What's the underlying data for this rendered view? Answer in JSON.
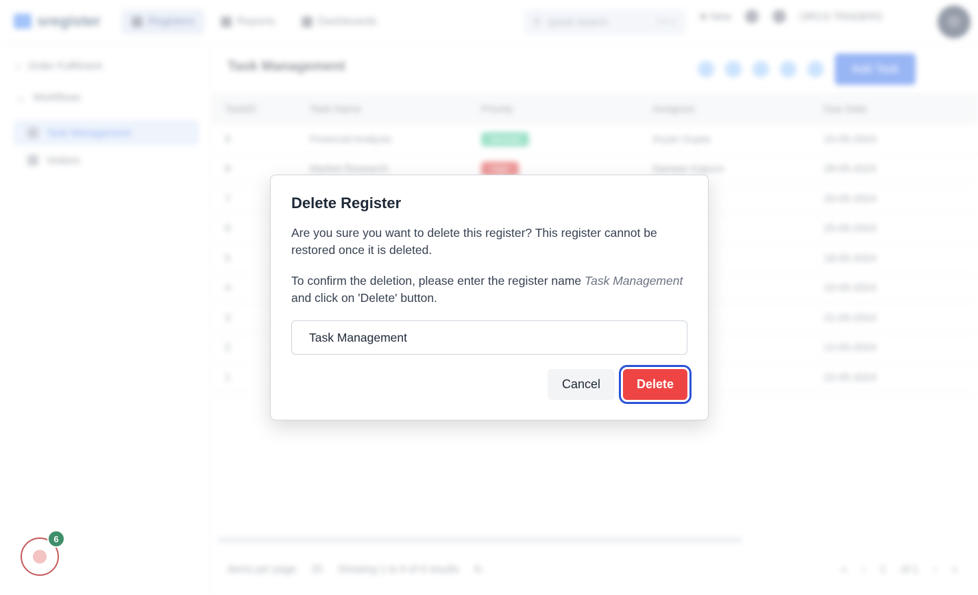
{
  "app": {
    "logo_text": "sregister",
    "nav": [
      "Registers",
      "Reports",
      "Dashboards"
    ],
    "quick_search": "Quick search",
    "quick_search_kbd": "Ctrl K",
    "new_label": "New",
    "org_name": "ORCO TRADERS",
    "avatar_initial": "O"
  },
  "sidebar": {
    "items": [
      {
        "label": "Order Fulfilment"
      },
      {
        "label": "Workflows"
      },
      {
        "label": "Task Management"
      },
      {
        "label": "Visitors"
      }
    ]
  },
  "main": {
    "title": "Task Management",
    "add_button": "Add Task",
    "columns": [
      "TaskID",
      "Task Name",
      "Priority",
      "Assignee",
      "Due Date"
    ],
    "rows": [
      {
        "id": "9",
        "name": "Financial Analysis",
        "priority": "Normal",
        "priority_color": "#34c38f",
        "assignee": "Aryan Gupta",
        "due": "15-05-2024"
      },
      {
        "id": "8",
        "name": "Market Research",
        "priority": "High",
        "priority_color": "#dc2626",
        "assignee": "Sameer Kapoor",
        "due": "28-05-2024"
      },
      {
        "id": "7",
        "name": "",
        "priority": "",
        "priority_color": "",
        "assignee": "",
        "due": "20-05-2024"
      },
      {
        "id": "6",
        "name": "",
        "priority": "",
        "priority_color": "",
        "assignee": "",
        "due": "25-05-2024"
      },
      {
        "id": "5",
        "name": "",
        "priority": "",
        "priority_color": "",
        "assignee": "",
        "due": "18-05-2024"
      },
      {
        "id": "4",
        "name": "",
        "priority": "",
        "priority_color": "",
        "assignee": "",
        "due": "10-05-2024"
      },
      {
        "id": "3",
        "name": "",
        "priority": "",
        "priority_color": "",
        "assignee": "",
        "due": "21-05-2024"
      },
      {
        "id": "2",
        "name": "",
        "priority": "",
        "priority_color": "",
        "assignee": "",
        "due": "12-05-2024"
      },
      {
        "id": "1",
        "name": "",
        "priority": "",
        "priority_color": "",
        "assignee": "",
        "due": "22-05-2024"
      }
    ],
    "footer": {
      "items_per_page_label": "Items per page",
      "items_per_page": "25",
      "showing": "Showing 1 to 9 of 9 results",
      "page": "1",
      "of_pages": "of 1"
    }
  },
  "dialog": {
    "title": "Delete Register",
    "message": "Are you sure you want to delete this register? This register cannot be restored once it is deleted.",
    "confirm_prefix": "To confirm the deletion, please enter the register name ",
    "confirm_name": "Task Management",
    "confirm_suffix": " and click on 'Delete' button.",
    "input_value": "Task Management",
    "cancel_label": "Cancel",
    "delete_label": "Delete"
  },
  "widget": {
    "badge_count": "6"
  },
  "colors": {
    "primary": "#2563eb",
    "danger": "#ef4444",
    "focus_ring": "#2b52d6",
    "badge": "#3f8f6a"
  }
}
